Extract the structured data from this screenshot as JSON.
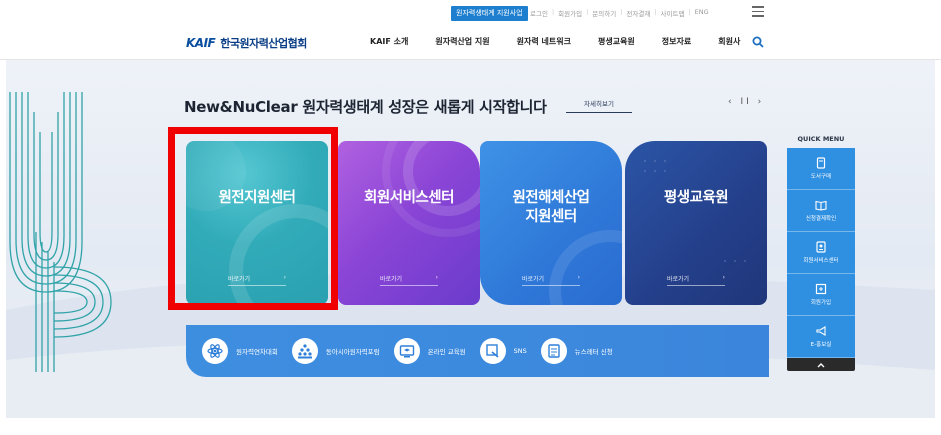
{
  "utility": {
    "support_label": "원자력생태계 지원사업",
    "links": [
      "로그인",
      "회원가입",
      "문의하기",
      "전자결재",
      "사이트맵",
      "ENG"
    ]
  },
  "header": {
    "logo_mark": "KAIF",
    "logo_text": "한국원자력산업협회",
    "menu": [
      "KAIF 소개",
      "원자력산업 지원",
      "원자력 네트워크",
      "평생교육원",
      "정보자료",
      "회원사"
    ]
  },
  "hero": {
    "headline": "New&NuClear 원자력생태계 성장은 새롭게 시작합니다",
    "more_label": "자세히보기",
    "pager": "‹ II ›",
    "cards": [
      {
        "title": "원전지원센터",
        "link": "바로가기",
        "arrow": "›"
      },
      {
        "title": "회원서비스센터",
        "link": "바로가기",
        "arrow": "›"
      },
      {
        "title": "원전해체산업\n지원센터",
        "link": "바로가기",
        "arrow": "›"
      },
      {
        "title": "평생교육원",
        "link": "바로가기",
        "arrow": "›"
      }
    ],
    "bar_items": [
      {
        "label": "원자력연차대회",
        "icon": "atom-icon"
      },
      {
        "label": "동아시아원자력포럼",
        "icon": "people-icon"
      },
      {
        "label": "온라인 교육원",
        "icon": "online-education-icon"
      },
      {
        "label": "SNS",
        "icon": "sns-icon"
      },
      {
        "label": "뉴스레터 신청",
        "icon": "newsletter-icon"
      }
    ]
  },
  "quick_menu": {
    "title": "QUICK MENU",
    "items": [
      {
        "label": "도서구매",
        "icon": "book-icon"
      },
      {
        "label": "신청결제확인",
        "icon": "open-book-icon"
      },
      {
        "label": "회원서비스센터",
        "icon": "member-card-icon"
      },
      {
        "label": "회원가입",
        "icon": "signup-icon"
      },
      {
        "label": "E-홍보실",
        "icon": "megaphone-icon"
      }
    ],
    "top_arrow": "^"
  },
  "colors": {
    "accent": "#2f8fe0",
    "highlight": "#f00000",
    "card1": "#32abb9",
    "card2": "#8b45d6",
    "card3": "#2f78d8",
    "card4": "#243f8a"
  }
}
